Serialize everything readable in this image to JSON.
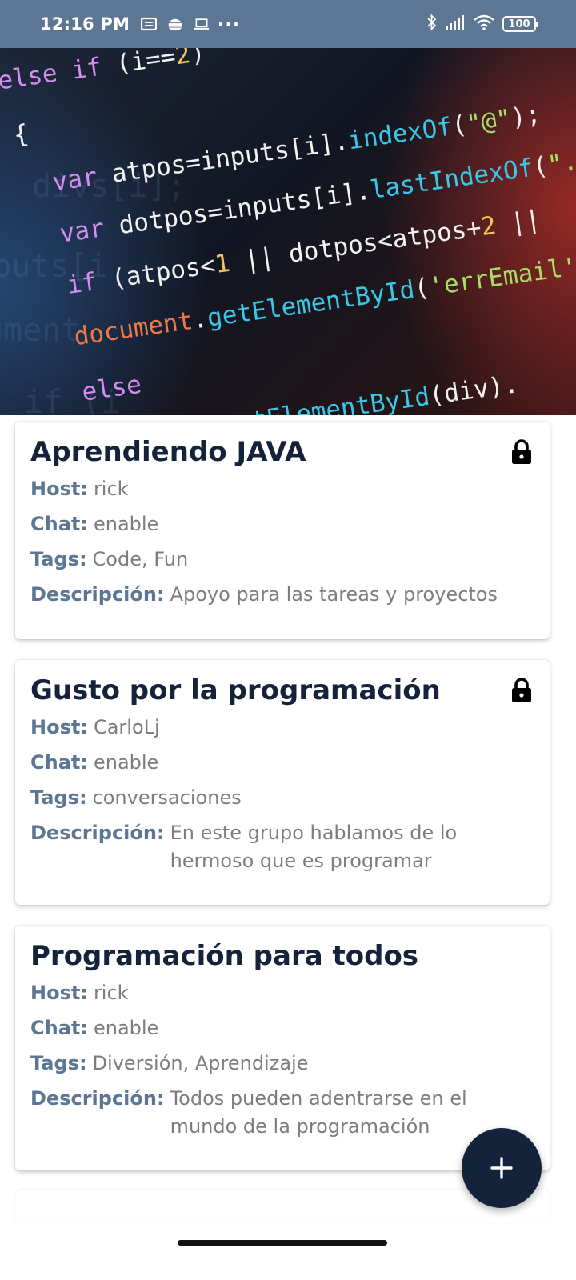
{
  "status_bar": {
    "time": "12:16 PM",
    "more": "···",
    "battery": "100"
  },
  "groups": [
    {
      "title": "Aprendiendo JAVA",
      "locked": true,
      "host_label": "Host:",
      "host": "rick",
      "chat_label": "Chat:",
      "chat": "enable",
      "tags_label": "Tags:",
      "tags": "Code, Fun",
      "description_label": "Descripción:",
      "description": "Apoyo para las tareas y proyectos"
    },
    {
      "title": "Gusto por la programación",
      "locked": true,
      "host_label": "Host:",
      "host": "CarloLj",
      "chat_label": "Chat:",
      "chat": "enable",
      "tags_label": "Tags:",
      "tags": "conversaciones",
      "description_label": "Descripción:",
      "description": "En este grupo hablamos de lo hermoso que es programar"
    },
    {
      "title": "Programación para todos",
      "locked": false,
      "host_label": "Host:",
      "host": "rick",
      "chat_label": "Chat:",
      "chat": "enable",
      "tags_label": "Tags:",
      "tags": "Diversión, Aprendizaje",
      "description_label": "Descripción:",
      "description": "Todos pueden adentrarse en el mundo de la programación"
    }
  ],
  "fab": {
    "icon": "plus-icon"
  },
  "colors": {
    "status_bar": "#5d7693",
    "title": "#14233a",
    "label": "#5d7693",
    "value": "#7d7d7d",
    "fab": "#14233a"
  }
}
